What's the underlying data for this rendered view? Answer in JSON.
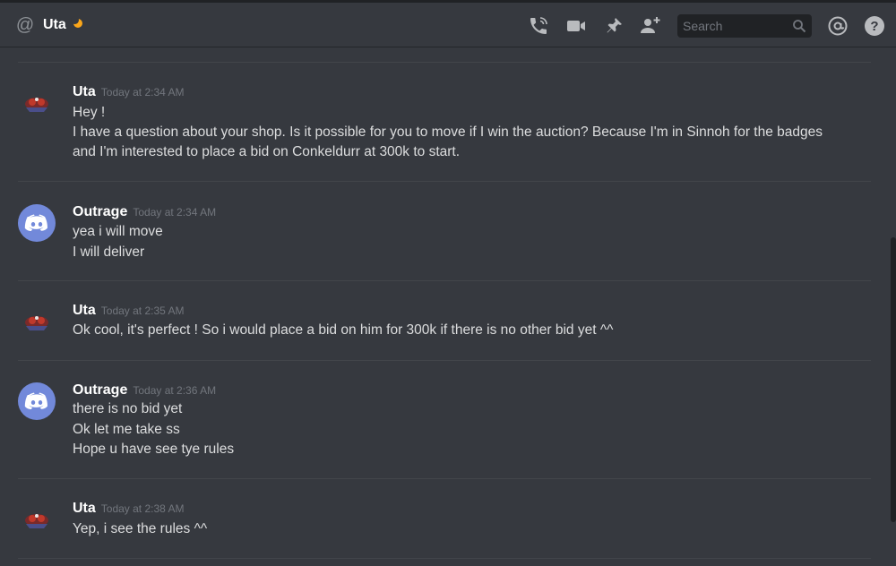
{
  "header": {
    "channel_name": "Uta",
    "search_placeholder": "Search"
  },
  "icons": {
    "call": "phone-icon",
    "video": "video-icon",
    "pin": "pin-icon",
    "add_friend": "add-user-icon",
    "search": "search-icon",
    "mentions": "at-icon",
    "help": "help-icon"
  },
  "colors": {
    "background": "#36393f",
    "discord_blurple": "#7289da",
    "idle_status": "#faa61a"
  },
  "messages": [
    {
      "author": "Uta",
      "timestamp": "Today at 2:34 AM",
      "lines": [
        "Hey !",
        "I have a question about your shop. Is it possible for you to move if I win the auction? Because I'm in Sinnoh for the badges",
        "and I'm interested to place a bid on Conkeldurr at 300k to start."
      ]
    },
    {
      "author": "Outrage",
      "timestamp": "Today at 2:34 AM",
      "lines": [
        "yea i will move",
        "I will deliver"
      ]
    },
    {
      "author": "Uta",
      "timestamp": "Today at 2:35 AM",
      "lines": [
        "Ok cool, it's perfect ! So i would place a bid on him for 300k if there is no other bid yet ^^"
      ]
    },
    {
      "author": "Outrage",
      "timestamp": "Today at 2:36 AM",
      "lines": [
        "there is no bid yet",
        "Ok let me take ss",
        "Hope u have see tye rules"
      ]
    },
    {
      "author": "Uta",
      "timestamp": "Today at 2:38 AM",
      "lines": [
        "Yep, i see the rules ^^"
      ]
    }
  ]
}
